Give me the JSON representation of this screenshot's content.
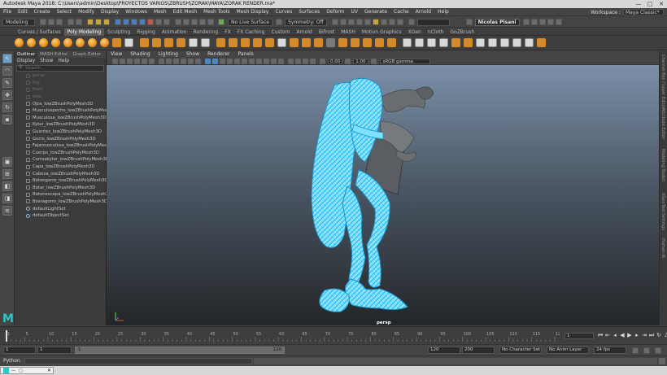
{
  "window": {
    "title": "Autodesk Maya 2018: C:\\Users\\admin\\Desktop\\PROYECTOS VARIOS\\ZBRUSH\\ZORAK\\MAYA\\ZORAK RENDER.ma*",
    "min": "—",
    "max": "□",
    "close": "✕"
  },
  "menu": {
    "items": [
      "File",
      "Edit",
      "Create",
      "Select",
      "Modify",
      "Display",
      "Windows",
      "Mesh",
      "Edit Mesh",
      "Mesh Tools",
      "Mesh Display",
      "Curves",
      "Surfaces",
      "Deform",
      "UV",
      "Generate",
      "Cache",
      "Arnold",
      "Help"
    ],
    "workspace_label": "Workspace :",
    "workspace_value": "Maya Classic*"
  },
  "status": {
    "mode": "Modeling",
    "live_surface": "No Live Surface",
    "symmetry": "Symmetry: Off",
    "user": "Nicolas Pisani"
  },
  "shelf": {
    "tabs": [
      "Curves / Surfaces",
      "Poly Modeling",
      "Sculpting",
      "Rigging",
      "Animation",
      "Rendering",
      "FX",
      "FX Caching",
      "Custom",
      "Arnold",
      "Bifrost",
      "MASH",
      "Motion Graphics",
      "XGen",
      "nCloth",
      "GoZBrush"
    ],
    "active_tab": "Poly Modeling"
  },
  "outliner": {
    "tabs": [
      "Outliner",
      "MASH Editor",
      "Graph Editor"
    ],
    "menu": [
      "Display",
      "Show",
      "Help"
    ],
    "search_placeholder": "Search...",
    "items": [
      {
        "label": "persp",
        "dim": true
      },
      {
        "label": "top",
        "dim": true
      },
      {
        "label": "front",
        "dim": true
      },
      {
        "label": "side",
        "dim": true
      },
      {
        "label": "Ojos_lowZBrushPolyMesh3D",
        "dim": false
      },
      {
        "label": "Musculospecho_lowZBrushPolyMesh3D",
        "dim": false
      },
      {
        "label": "Musculosa_lowZBrushPolyMesh3D",
        "dim": false
      },
      {
        "label": "Kytar_lowZBrushPolyMesh3D",
        "dim": false
      },
      {
        "label": "Guantes_lowZBrushPolyMesh3D",
        "dim": false
      },
      {
        "label": "Gorro_lowZBrushPolyMesh3D",
        "dim": false
      },
      {
        "label": "Fajamusculosa_lowZBrushPolyMesh3D",
        "dim": false
      },
      {
        "label": "Cuerpo_lowZBrushPolyMesh3D",
        "dim": false
      },
      {
        "label": "Correakytar_lowZBrushPolyMesh3D",
        "dim": false
      },
      {
        "label": "Capa_lowZBrushPolyMesh3D",
        "dim": false
      },
      {
        "label": "Cabeza_lowZBrushPolyMesh3D",
        "dim": false
      },
      {
        "label": "Botongorro_lowZBrushPolyMesh3D",
        "dim": false
      },
      {
        "label": "Botar_lowZBrushPolyMesh3D",
        "dim": false
      },
      {
        "label": "Botonescapa_lowZBrushPolyMesh3D",
        "dim": false
      },
      {
        "label": "Bosragorro_lowZBrushPolyMesh3D",
        "dim": false
      },
      {
        "label": "defaultLightSet",
        "dim": false,
        "set": true
      },
      {
        "label": "defaultObjectSet",
        "dim": false,
        "set": true
      }
    ]
  },
  "viewport": {
    "menu": [
      "View",
      "Shading",
      "Lighting",
      "Show",
      "Renderer",
      "Panels"
    ],
    "near": "0.00",
    "far": "1.00",
    "color_mgmt": "sRGB gamma",
    "camera": "persp"
  },
  "right_tabs": [
    "Channel Box / Layer Editor",
    "Attribute Editor",
    "Modeling Toolkit",
    "XGen",
    "Tool Settings",
    "Human IK"
  ],
  "time": {
    "ticks": [
      "1",
      "5",
      "10",
      "15",
      "20",
      "25",
      "30",
      "35",
      "40",
      "45",
      "50",
      "55",
      "60",
      "65",
      "70",
      "75",
      "80",
      "85",
      "90",
      "95",
      "100",
      "105",
      "110",
      "115",
      "120"
    ],
    "current_frame": "1",
    "range_start": "1",
    "range_inner_start": "1",
    "range_bar_start": "1",
    "range_bar_end": "120",
    "range_end": "120",
    "anim_end": "200",
    "character_set": "No Character Set",
    "anim_layer": "No Anim Layer",
    "fps": "24 fps"
  },
  "command": {
    "language": "Python"
  }
}
